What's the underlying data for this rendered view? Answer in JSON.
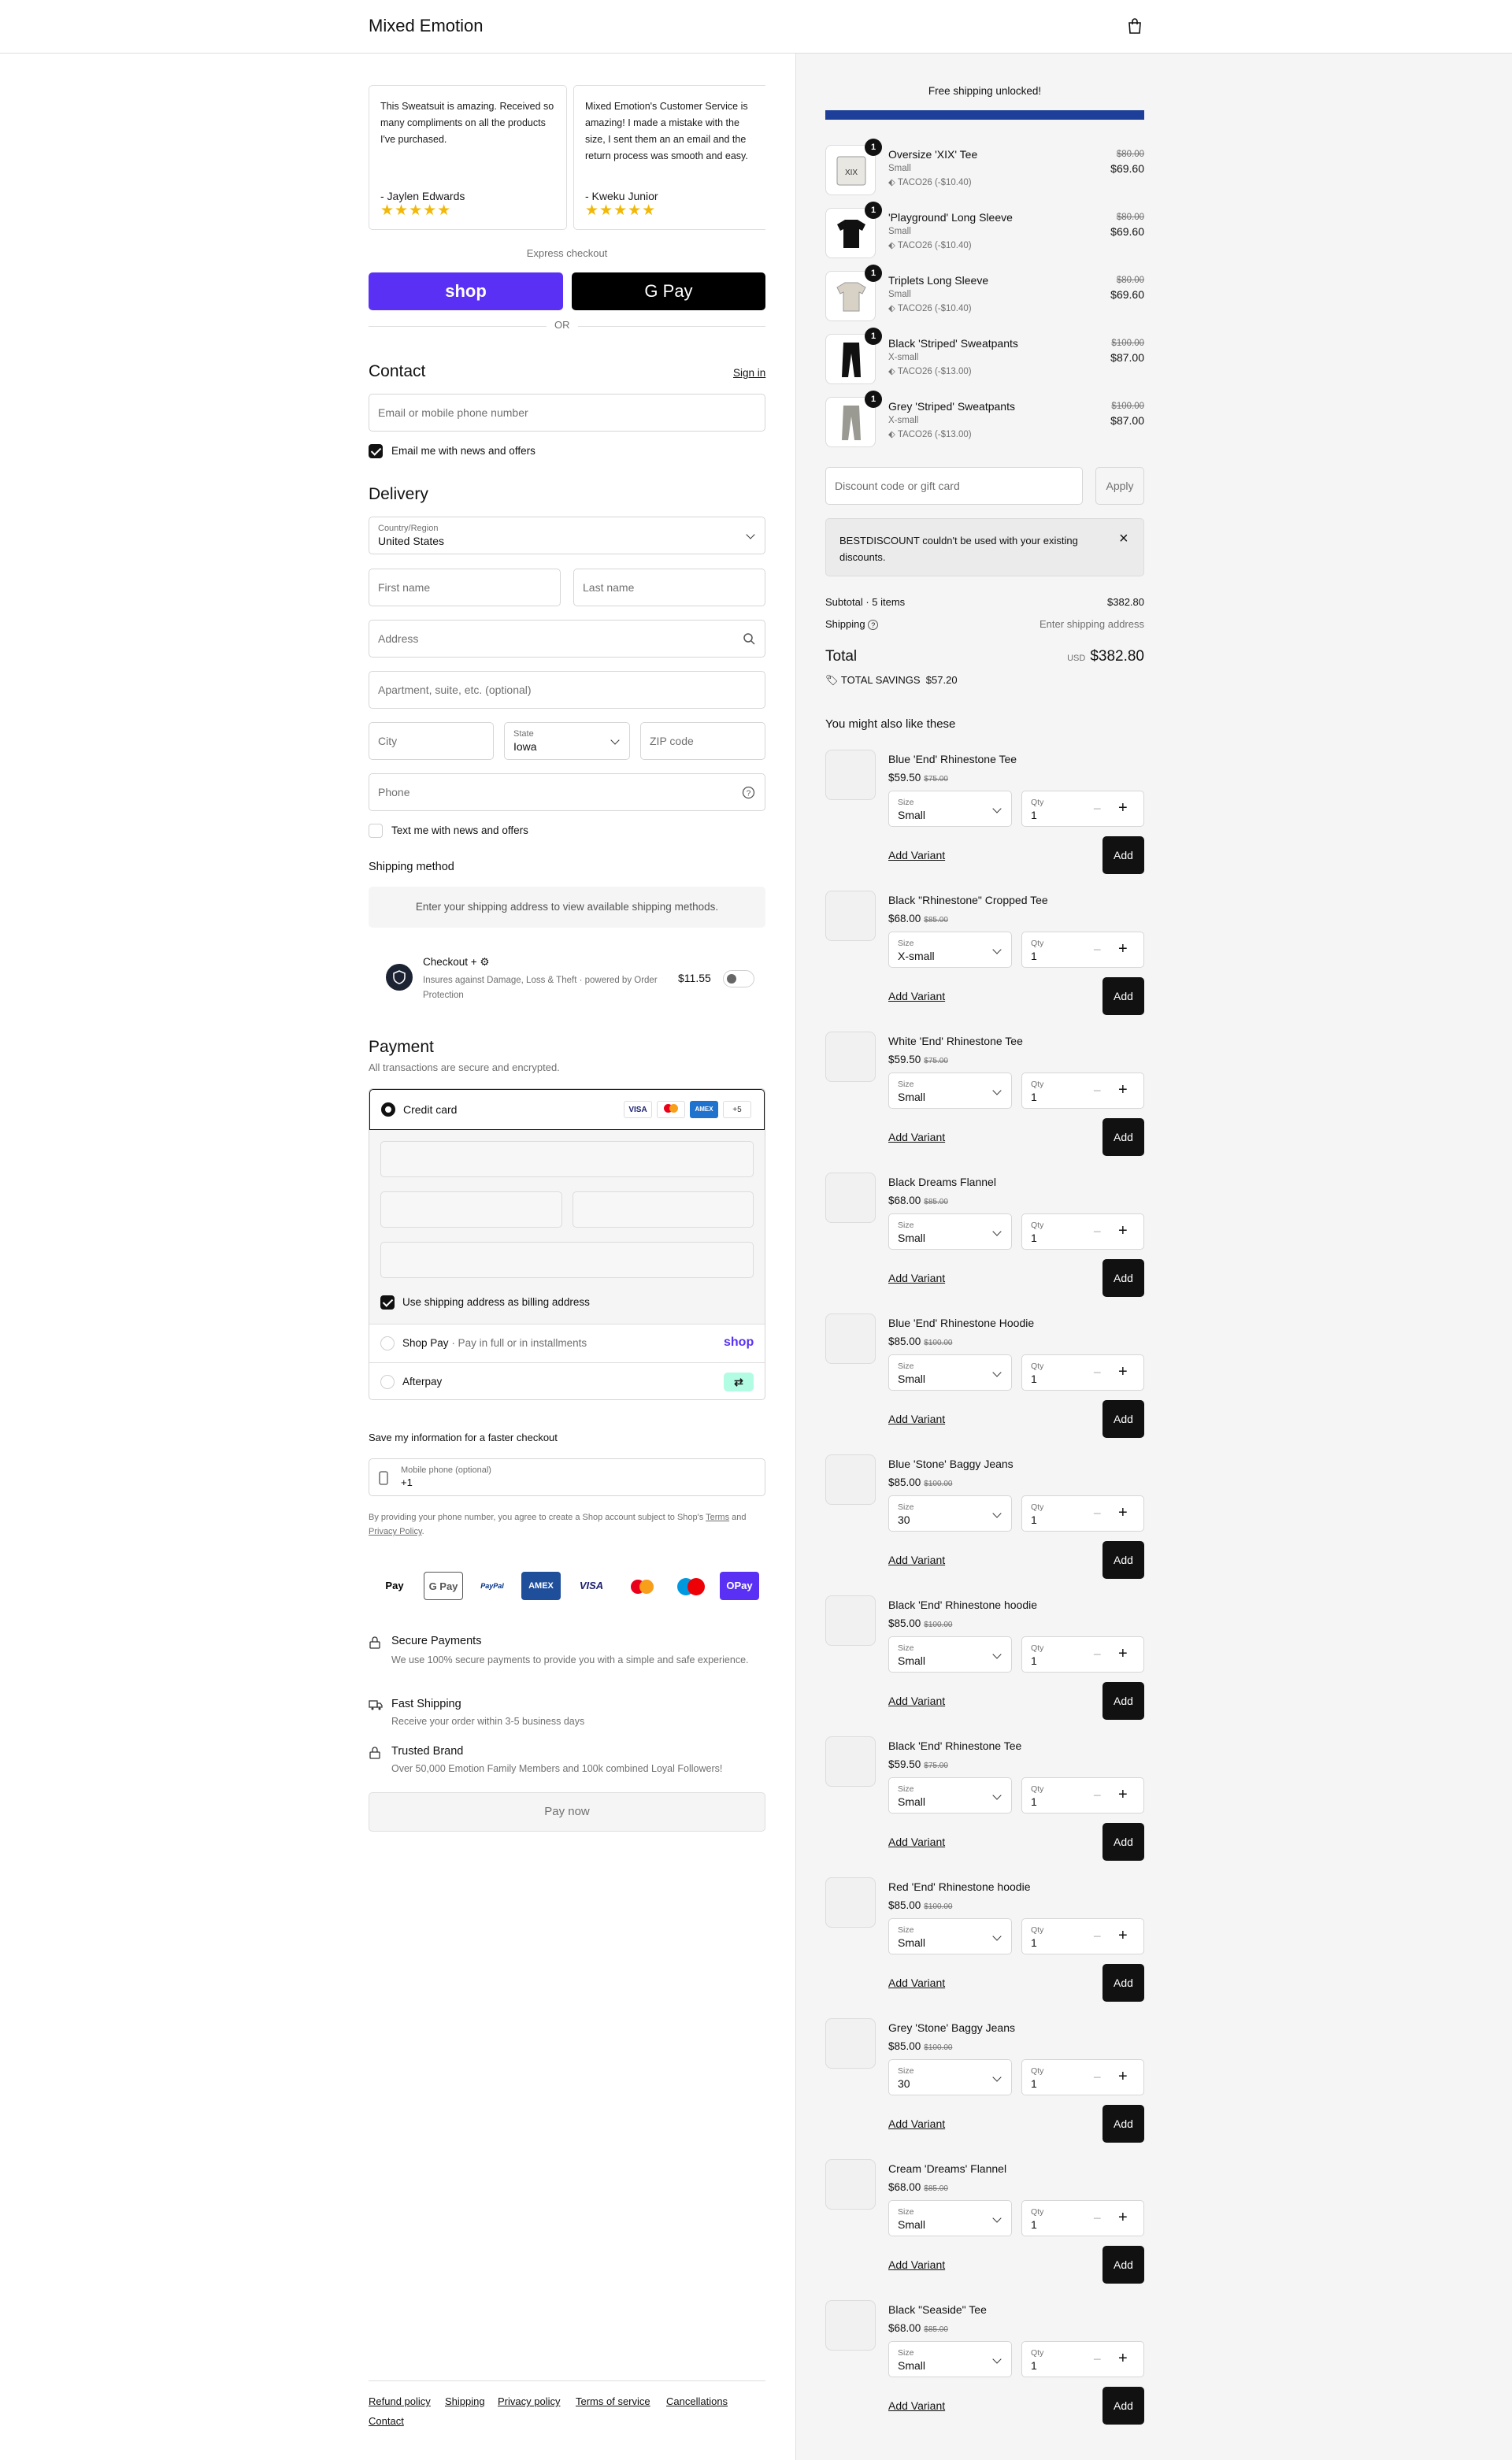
{
  "header": {
    "brand": "Mixed Emotion"
  },
  "reviews": [
    {
      "text": "This Sweatsuit is amazing. Received so many compliments on all the products I've purchased.",
      "author": "- Jaylen Edwards",
      "stars": "★★★★★"
    },
    {
      "text": "Mixed Emotion's Customer Service is amazing! I made a mistake with the size, I sent them an an email and the return process was smooth and easy.",
      "author": "- Kweku Junior",
      "stars": "★★★★★"
    }
  ],
  "express": {
    "label": "Express checkout",
    "shop": "shop",
    "gpay": "G Pay",
    "or": "OR"
  },
  "contact": {
    "title": "Contact",
    "signin": "Sign in",
    "email_placeholder": "Email or mobile phone number",
    "news": "Email me with news and offers"
  },
  "delivery": {
    "title": "Delivery",
    "country_label": "Country/Region",
    "country": "United States",
    "first": "First name",
    "last": "Last name",
    "address": "Address",
    "apt": "Apartment, suite, etc. (optional)",
    "city": "City",
    "state_label": "State",
    "state": "Iowa",
    "zip": "ZIP code",
    "phone": "Phone",
    "text_news": "Text me with news and offers"
  },
  "shipping": {
    "title": "Shipping method",
    "msg": "Enter your shipping address to view available shipping methods."
  },
  "protect": {
    "title": "Checkout + ⚙",
    "desc": "Insures against Damage, Loss & Theft · powered by Order Protection",
    "price": "$11.55"
  },
  "payment": {
    "title": "Payment",
    "sub": "All transactions are secure and encrypted.",
    "credit": "Credit card",
    "more": "+5",
    "billing": "Use shipping address as billing address",
    "shoppay": "Shop Pay",
    "shoppay_sub": "· Pay in full or in installments",
    "shoppay_logo": "shop",
    "afterpay": "Afterpay"
  },
  "save": {
    "title": "Save my information for a faster checkout",
    "mobile_label": "Mobile phone (optional)",
    "mobile_val": "+1",
    "legal_a": "By providing your phone number, you agree to create a Shop account subject to Shop's ",
    "terms": "Terms",
    "legal_b": " and ",
    "privacy": "Privacy Policy",
    "legal_c": "."
  },
  "pay_logos": [
    "Pay",
    "G Pay",
    "PayPal",
    "AMEX",
    "VISA",
    "MC",
    "Maestro",
    "OPay"
  ],
  "trust": [
    {
      "title": "Secure Payments",
      "desc": "We use 100% secure payments to provide you with a simple and safe experience."
    },
    {
      "title": "Fast Shipping",
      "desc": "Receive your order within 3-5 business days"
    },
    {
      "title": "Trusted Brand",
      "desc": "Over 50,000 Emotion Family Members and 100k combined Loyal Followers!"
    }
  ],
  "pay_now": "Pay now",
  "footer": [
    "Refund policy",
    "Shipping",
    "Privacy policy",
    "Terms of service",
    "Cancellations",
    "Contact"
  ],
  "cart": {
    "free_ship": "Free shipping unlocked!",
    "progress": 1.0,
    "items": [
      {
        "qty": "1",
        "name": "Oversize 'XIX' Tee",
        "variant": "Small",
        "disc": "TACO26 (-$10.40)",
        "old": "$80.00",
        "new": "$69.60"
      },
      {
        "qty": "1",
        "name": "'Playground' Long Sleeve",
        "variant": "Small",
        "disc": "TACO26 (-$10.40)",
        "old": "$80.00",
        "new": "$69.60"
      },
      {
        "qty": "1",
        "name": "Triplets Long Sleeve",
        "variant": "Small",
        "disc": "TACO26 (-$10.40)",
        "old": "$80.00",
        "new": "$69.60"
      },
      {
        "qty": "1",
        "name": "Black 'Striped' Sweatpants",
        "variant": "X-small",
        "disc": "TACO26 (-$13.00)",
        "old": "$100.00",
        "new": "$87.00"
      },
      {
        "qty": "1",
        "name": "Grey 'Striped' Sweatpants",
        "variant": "X-small",
        "disc": "TACO26 (-$13.00)",
        "old": "$100.00",
        "new": "$87.00"
      }
    ],
    "discount_placeholder": "Discount code or gift card",
    "apply": "Apply",
    "error": "BESTDISCOUNT couldn't be used with your existing discounts.",
    "subtotal_label": "Subtotal · 5 items",
    "subtotal": "$382.80",
    "shipping_label": "Shipping",
    "shipping_val": "Enter shipping address",
    "total_label": "Total",
    "currency": "USD",
    "total": "$382.80",
    "savings_label": "TOTAL SAVINGS",
    "savings": "$57.20"
  },
  "recs": {
    "title": "You might also like these",
    "size_label": "Size",
    "qty_label": "Qty",
    "add": "Add",
    "add_variant": "Add Variant",
    "items": [
      {
        "name": "Blue 'End' Rhinestone Tee",
        "price": "$59.50",
        "old": "$75.00",
        "size": "Small",
        "qty": "1"
      },
      {
        "name": "Black \"Rhinestone\" Cropped Tee",
        "price": "$68.00",
        "old": "$85.00",
        "size": "X-small",
        "qty": "1"
      },
      {
        "name": "White 'End' Rhinestone Tee",
        "price": "$59.50",
        "old": "$75.00",
        "size": "Small",
        "qty": "1"
      },
      {
        "name": "Black Dreams Flannel",
        "price": "$68.00",
        "old": "$85.00",
        "size": "Small",
        "qty": "1"
      },
      {
        "name": "Blue 'End' Rhinestone Hoodie",
        "price": "$85.00",
        "old": "$100.00",
        "size": "Small",
        "qty": "1"
      },
      {
        "name": "Blue 'Stone' Baggy Jeans",
        "price": "$85.00",
        "old": "$100.00",
        "size": "30",
        "qty": "1"
      },
      {
        "name": "Black 'End' Rhinestone hoodie",
        "price": "$85.00",
        "old": "$100.00",
        "size": "Small",
        "qty": "1"
      },
      {
        "name": "Black 'End' Rhinestone Tee",
        "price": "$59.50",
        "old": "$75.00",
        "size": "Small",
        "qty": "1"
      },
      {
        "name": "Red 'End' Rhinestone hoodie",
        "price": "$85.00",
        "old": "$100.00",
        "size": "Small",
        "qty": "1"
      },
      {
        "name": "Grey 'Stone' Baggy Jeans",
        "price": "$85.00",
        "old": "$100.00",
        "size": "30",
        "qty": "1"
      },
      {
        "name": "Cream 'Dreams' Flannel",
        "price": "$68.00",
        "old": "$85.00",
        "size": "Small",
        "qty": "1"
      },
      {
        "name": "Black \"Seaside\" Tee",
        "price": "$68.00",
        "old": "$85.00",
        "size": "Small",
        "qty": "1"
      }
    ]
  },
  "colors": {
    "shop": "#5a31f4",
    "progress": "#1d3f9a",
    "star": "#f2b807"
  }
}
